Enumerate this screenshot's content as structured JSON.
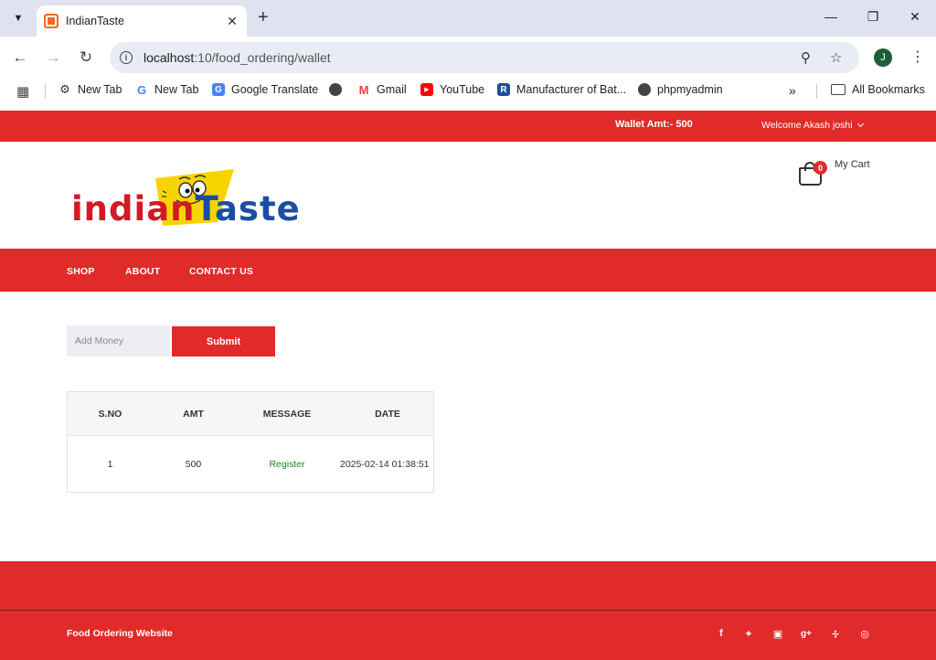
{
  "browser": {
    "tab_title": "IndianTaste",
    "url_host": "localhost",
    "url_path": ":10/food_ordering/wallet",
    "profile_initial": "J",
    "bookmarks": [
      {
        "label": "New Tab",
        "icon": "gear-icon"
      },
      {
        "label": "New Tab",
        "icon": "google-icon"
      },
      {
        "label": "Google Translate",
        "icon": "translate-icon"
      },
      {
        "label": "",
        "icon": "globe-icon"
      },
      {
        "label": "Gmail",
        "icon": "gmail-icon"
      },
      {
        "label": "YouTube",
        "icon": "youtube-icon"
      },
      {
        "label": "Manufacturer of Bat...",
        "icon": "r-icon"
      },
      {
        "label": "phpmyadmin",
        "icon": "globe-icon"
      }
    ],
    "all_bookmarks": "All Bookmarks"
  },
  "topbar": {
    "wallet": "Wallet Amt:- 500",
    "welcome": "Welcome Akash joshi"
  },
  "header": {
    "logo_part1": "indian",
    "logo_part2": "Taste",
    "cart_count": "0",
    "cart_label": "My Cart"
  },
  "nav": [
    "SHOP",
    "ABOUT",
    "CONTACT US"
  ],
  "form": {
    "placeholder": "Add Money",
    "submit": "Submit"
  },
  "table": {
    "headers": [
      "S.NO",
      "AMT",
      "MESSAGE",
      "DATE"
    ],
    "rows": [
      [
        "1",
        "500",
        "Register",
        "2025-02-14 01:38:51"
      ]
    ]
  },
  "footer": {
    "text": "Food Ordering Website",
    "social": [
      "facebook-icon",
      "twitter-icon",
      "instagram-icon",
      "google-plus-icon",
      "rss-icon",
      "dribbble-icon"
    ]
  },
  "colors": {
    "brand_red": "#e12b2b",
    "logo_red": "#d21a24",
    "logo_blue": "#1b4ea3",
    "message_green": "#1c8a1c"
  }
}
